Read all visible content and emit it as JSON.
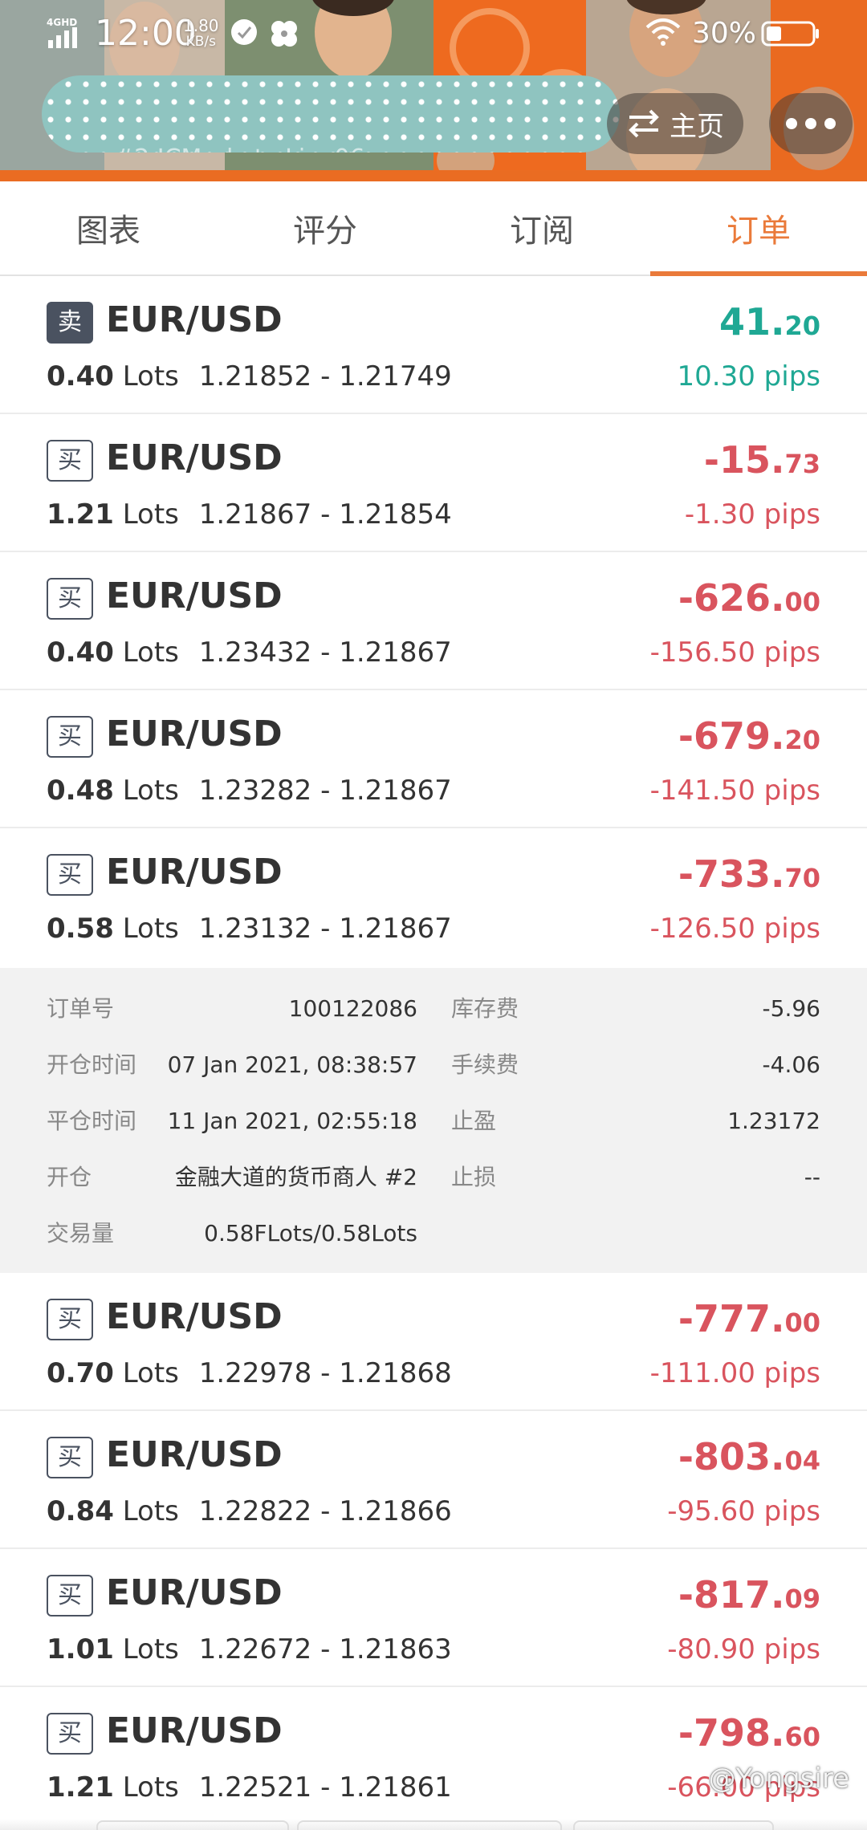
{
  "status_bar": {
    "network": "4GHD",
    "time": "12:00",
    "speed_value": "1.80",
    "speed_unit": "KB/s",
    "battery": "30%"
  },
  "header": {
    "title_obscured": "#2   ICMarkets-Live06",
    "home_label": "主页",
    "icons": [
      "swap-arrows-icon",
      "more-dots-icon"
    ]
  },
  "tabs": [
    {
      "label": "图表",
      "active": false
    },
    {
      "label": "评分",
      "active": false
    },
    {
      "label": "订阅",
      "active": false
    },
    {
      "label": "订单",
      "active": true
    }
  ],
  "orders": [
    {
      "type": "卖",
      "side": "sell",
      "symbol": "EUR/USD",
      "lots": "0.40",
      "lots_unit": "Lots",
      "prices": "1.21852 - 1.21749",
      "profit_int": "41.",
      "profit_dec": "20",
      "pips": "10.30 pips",
      "positive": true
    },
    {
      "type": "买",
      "side": "buy",
      "symbol": "EUR/USD",
      "lots": "1.21",
      "lots_unit": "Lots",
      "prices": "1.21867 - 1.21854",
      "profit_int": "-15.",
      "profit_dec": "73",
      "pips": "-1.30 pips",
      "positive": false
    },
    {
      "type": "买",
      "side": "buy",
      "symbol": "EUR/USD",
      "lots": "0.40",
      "lots_unit": "Lots",
      "prices": "1.23432 - 1.21867",
      "profit_int": "-626.",
      "profit_dec": "00",
      "pips": "-156.50 pips",
      "positive": false
    },
    {
      "type": "买",
      "side": "buy",
      "symbol": "EUR/USD",
      "lots": "0.48",
      "lots_unit": "Lots",
      "prices": "1.23282 - 1.21867",
      "profit_int": "-679.",
      "profit_dec": "20",
      "pips": "-141.50 pips",
      "positive": false
    },
    {
      "type": "买",
      "side": "buy",
      "symbol": "EUR/USD",
      "lots": "0.58",
      "lots_unit": "Lots",
      "prices": "1.23132 - 1.21867",
      "profit_int": "-733.",
      "profit_dec": "70",
      "pips": "-126.50 pips",
      "positive": false
    },
    {
      "type": "买",
      "side": "buy",
      "symbol": "EUR/USD",
      "lots": "0.70",
      "lots_unit": "Lots",
      "prices": "1.22978 - 1.21868",
      "profit_int": "-777.",
      "profit_dec": "00",
      "pips": "-111.00 pips",
      "positive": false
    },
    {
      "type": "买",
      "side": "buy",
      "symbol": "EUR/USD",
      "lots": "0.84",
      "lots_unit": "Lots",
      "prices": "1.22822 - 1.21866",
      "profit_int": "-803.",
      "profit_dec": "04",
      "pips": "-95.60 pips",
      "positive": false
    },
    {
      "type": "买",
      "side": "buy",
      "symbol": "EUR/USD",
      "lots": "1.01",
      "lots_unit": "Lots",
      "prices": "1.22672 - 1.21863",
      "profit_int": "-817.",
      "profit_dec": "09",
      "pips": "-80.90 pips",
      "positive": false
    },
    {
      "type": "买",
      "side": "buy",
      "symbol": "EUR/USD",
      "lots": "1.21",
      "lots_unit": "Lots",
      "prices": "1.22521 - 1.21861",
      "profit_int": "-798.",
      "profit_dec": "60",
      "pips": "-66.00 pips",
      "positive": false
    }
  ],
  "order_detail": {
    "order_no_label": "订单号",
    "order_no": "100122086",
    "swap_label": "库存费",
    "swap": "-5.96",
    "open_time_label": "开仓时间",
    "open_time": "07 Jan 2021, 08:38:57",
    "commission_label": "手续费",
    "commission": "-4.06",
    "close_time_label": "平仓时间",
    "close_time": "11 Jan 2021, 02:55:18",
    "take_profit_label": "止盈",
    "take_profit": "1.23172",
    "open_label": "开仓",
    "open_account": "金融大道的货币商人  #2",
    "stop_loss_label": "止损",
    "stop_loss": "--",
    "volume_label": "交易量",
    "volume": "0.58FLots/0.58Lots"
  },
  "watermark": "@Yongsire",
  "colors": {
    "accent": "#ea7a3a",
    "profit_positive": "#1fa894",
    "profit_negative": "#d9545e",
    "badge": "#4a5260"
  }
}
